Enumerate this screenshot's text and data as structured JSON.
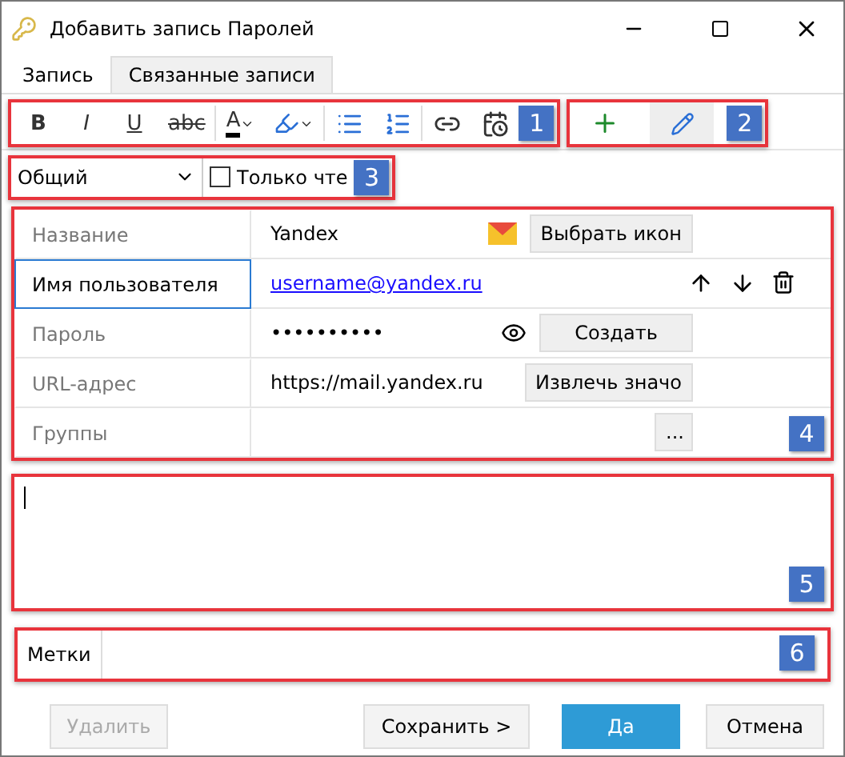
{
  "window": {
    "title": "Добавить запись Паролей"
  },
  "tabs": [
    {
      "label": "Запись",
      "selected": true
    },
    {
      "label": "Связанные записи",
      "selected": false
    }
  ],
  "format_toolbar": {
    "callout": "1",
    "buttons": [
      {
        "kind": "bold",
        "label": "B"
      },
      {
        "kind": "italic",
        "label": "I"
      },
      {
        "kind": "underline",
        "label": "U"
      },
      {
        "kind": "strike",
        "label": "abc"
      },
      {
        "kind": "fontcolor",
        "label": "A"
      },
      {
        "kind": "highlight"
      },
      {
        "kind": "bullets"
      },
      {
        "kind": "numbers"
      },
      {
        "kind": "link"
      },
      {
        "kind": "date"
      }
    ]
  },
  "edit_toolbar": {
    "callout": "2",
    "buttons": [
      {
        "kind": "add"
      },
      {
        "kind": "edit"
      }
    ]
  },
  "options": {
    "callout": "3",
    "category": "Общий",
    "read_only": {
      "label": "Только чте",
      "checked": false
    }
  },
  "fields": {
    "callout": "4",
    "rows": [
      {
        "kind": "text",
        "label": "Название",
        "value": "Yandex",
        "selected": false,
        "button": "Выбрать икон"
      },
      {
        "kind": "link",
        "label": "Имя пользователя",
        "value": "username@yandex.ru",
        "selected": true
      },
      {
        "kind": "password",
        "label": "Пароль",
        "value": "••••••••••",
        "selected": false,
        "button": "Создать"
      },
      {
        "kind": "text",
        "label": "URL-адрес",
        "value": "https://mail.yandex.ru",
        "selected": false,
        "button": "Извлечь значо"
      },
      {
        "kind": "groups",
        "label": "Группы",
        "selected": false,
        "button": "..."
      }
    ]
  },
  "notes": {
    "callout": "5"
  },
  "tags": {
    "callout": "6",
    "label": "Метки"
  },
  "buttons": [
    {
      "kind": "default",
      "label": "Удалить",
      "disabled": true
    },
    {
      "kind": "default",
      "label": "Сохранить >",
      "disabled": false
    },
    {
      "kind": "primary",
      "label": "Да",
      "disabled": false
    },
    {
      "kind": "default",
      "label": "Отмена",
      "disabled": false
    }
  ]
}
